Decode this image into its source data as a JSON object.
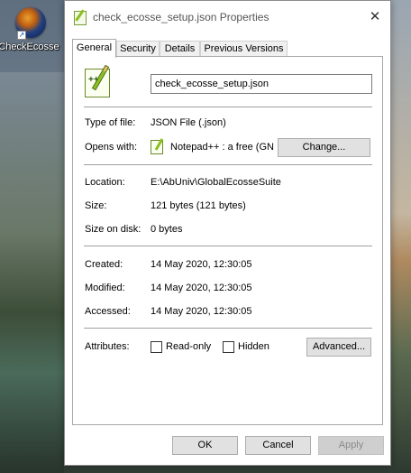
{
  "desktop": {
    "icon_label": "CheckEcosse"
  },
  "window": {
    "title": "check_ecosse_setup.json Properties",
    "close_glyph": "✕"
  },
  "tabs": [
    {
      "label": "General"
    },
    {
      "label": "Security"
    },
    {
      "label": "Details"
    },
    {
      "label": "Previous Versions"
    }
  ],
  "general": {
    "file_name": "check_ecosse_setup.json",
    "type_label": "Type of file:",
    "type_value": "JSON File (.json)",
    "opens_label": "Opens with:",
    "opens_value": "Notepad++ : a free (GN",
    "change_button": "Change...",
    "location_label": "Location:",
    "location_value": "E:\\AbUniv\\GlobalEcosseSuite",
    "size_label": "Size:",
    "size_value": "121 bytes (121 bytes)",
    "size_disk_label": "Size on disk:",
    "size_disk_value": "0 bytes",
    "created_label": "Created:",
    "created_value": "14 May 2020, 12:30:05",
    "modified_label": "Modified:",
    "modified_value": "14 May 2020, 12:30:05",
    "accessed_label": "Accessed:",
    "accessed_value": "14 May 2020, 12:30:05",
    "attributes_label": "Attributes:",
    "readonly_label": "Read-only",
    "readonly_checked": false,
    "hidden_label": "Hidden",
    "hidden_checked": false,
    "advanced_button": "Advanced..."
  },
  "footer": {
    "ok": "OK",
    "cancel": "Cancel",
    "apply": "Apply"
  },
  "icons": [
    "globe-app-icon",
    "shortcut-arrow-icon",
    "notepadpp-file-icon",
    "notepadpp-icon",
    "close-icon"
  ]
}
